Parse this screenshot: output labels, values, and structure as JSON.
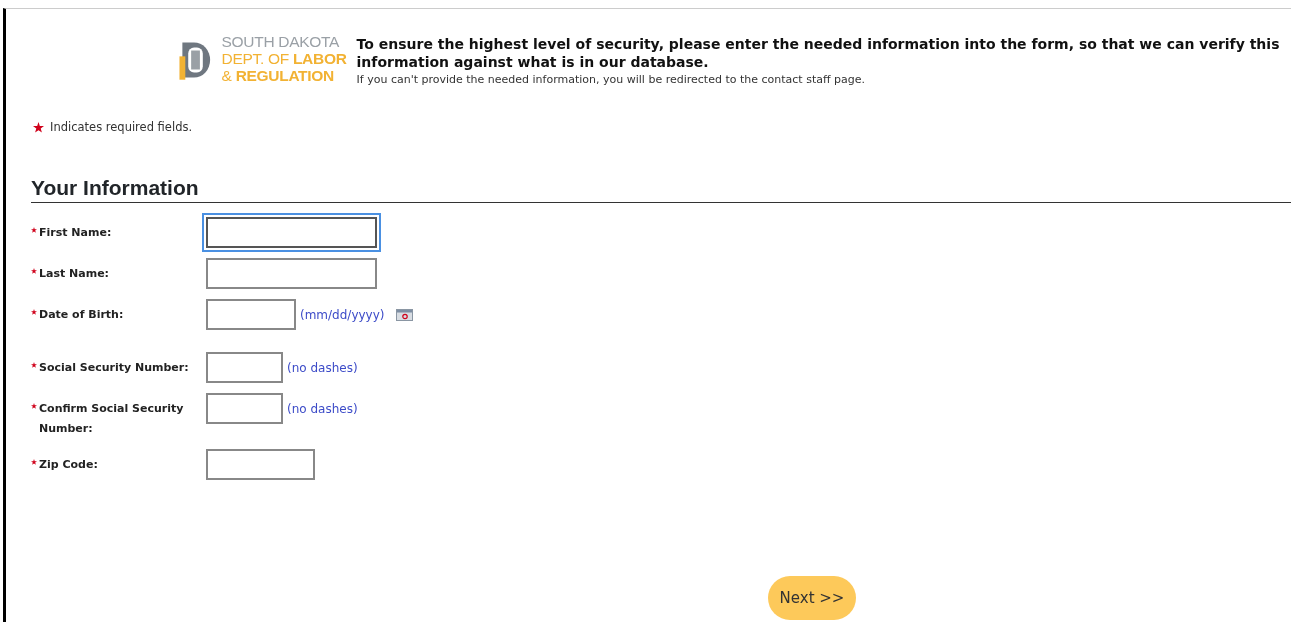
{
  "header": {
    "logo_lines": [
      "SOUTH DAKOTA",
      "DEPT. OF **LABOR**",
      "& **REGULATION**"
    ],
    "headline": "To ensure the highest level of security, please enter the needed information into the form, so that we can verify this information against what is in our database.",
    "note": "If you can't provide the needed information, you will be redirected to the contact staff page."
  },
  "legend": {
    "text": "Indicates required fields."
  },
  "section": {
    "title": "Your Information"
  },
  "fields": [
    {
      "label": "First Name:",
      "required": true,
      "focused": true,
      "kind": "text"
    },
    {
      "label": "Last Name:",
      "required": true,
      "focused": false,
      "kind": "text"
    },
    {
      "label": "Date of Birth:",
      "required": true,
      "focused": false,
      "hint": "(mm/dd/yyyy)",
      "kind": "date"
    },
    {
      "label": "Social Security Number:",
      "required": true,
      "focused": false,
      "hint": "(no dashes)",
      "kind": "text"
    },
    {
      "label": "Confirm Social Security Number:",
      "required": true,
      "focused": false,
      "hint": "(no dashes)",
      "kind": "text"
    },
    {
      "label": "Zip Code:",
      "required": true,
      "focused": false,
      "kind": "text"
    }
  ],
  "next_button": {
    "label": "Next >>"
  }
}
